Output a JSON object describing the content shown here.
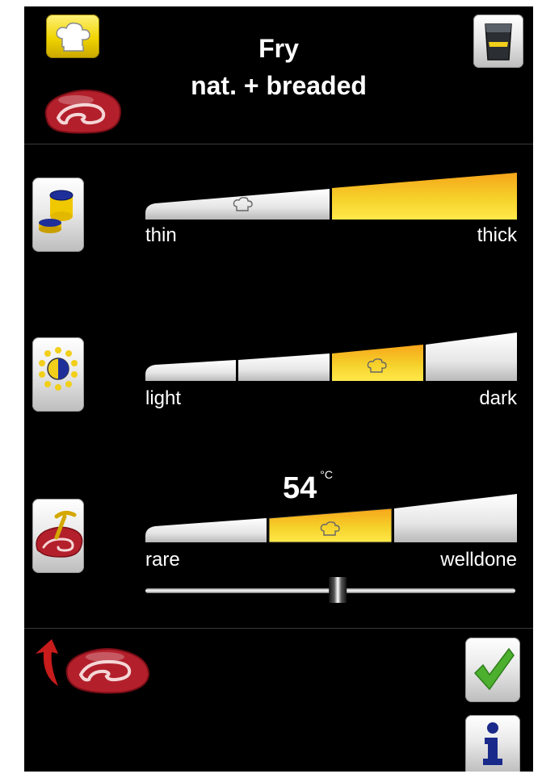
{
  "header": {
    "title_line1": "Fry",
    "title_line2": "nat. + breaded"
  },
  "icons": {
    "mode": "chef-hat-icon",
    "food": "steak-icon",
    "device": "cooking-unit-icon",
    "thickness": "thickness-icon",
    "browning": "browning-icon",
    "core_temp": "core-probe-icon",
    "back": "back-arrow-icon",
    "confirm": "checkmark-icon",
    "info": "info-icon"
  },
  "colors": {
    "active_segment": "#f2cf1a",
    "segment": "#e0e0e0",
    "steak": "#b3202c",
    "check": "#4caf2e",
    "arrow": "#c81b1b"
  },
  "thickness": {
    "left_label": "thin",
    "right_label": "thick",
    "segments": 2,
    "selected": 2
  },
  "browning": {
    "left_label": "light",
    "right_label": "dark",
    "segments": 4,
    "selected": 3
  },
  "doneness": {
    "left_label": "rare",
    "right_label": "welldone",
    "segments": 3,
    "selected": 2,
    "temperature": "54",
    "unit": "°C",
    "fine_slider_fraction": 0.52
  }
}
